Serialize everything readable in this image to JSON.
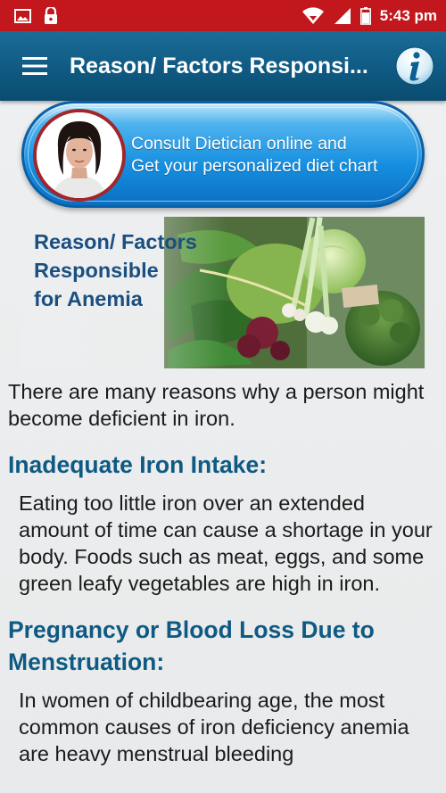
{
  "status_bar": {
    "time": "5:43 pm",
    "icons": [
      "image-icon",
      "lock-icon",
      "wifi-icon",
      "signal-icon",
      "battery-icon"
    ],
    "color": "#c2181d"
  },
  "app_bar": {
    "title": "Reason/ Factors Responsi...",
    "menu_icon": "hamburger-icon",
    "info_icon": "info-icon",
    "color": "#0f5a83"
  },
  "consult_banner": {
    "line1": "Consult Dietician online and",
    "line2": "Get your personalized diet chart"
  },
  "hero": {
    "title_lines": [
      "Reason/ Factors",
      "Responsible",
      "for Anemia"
    ]
  },
  "article": {
    "intro": "There are many reasons why a person might become deficient in iron.",
    "sections": [
      {
        "heading": "Inadequate Iron Intake:",
        "body": "Eating too little iron over an extended amount of time can cause a shortage in your body. Foods such as meat, eggs, and some green leafy vegetables are high in iron."
      },
      {
        "heading": "Pregnancy or Blood Loss Due to Menstruation:",
        "body": "In women of childbearing age, the most common causes of iron deficiency anemia are heavy menstrual bleeding"
      }
    ]
  }
}
